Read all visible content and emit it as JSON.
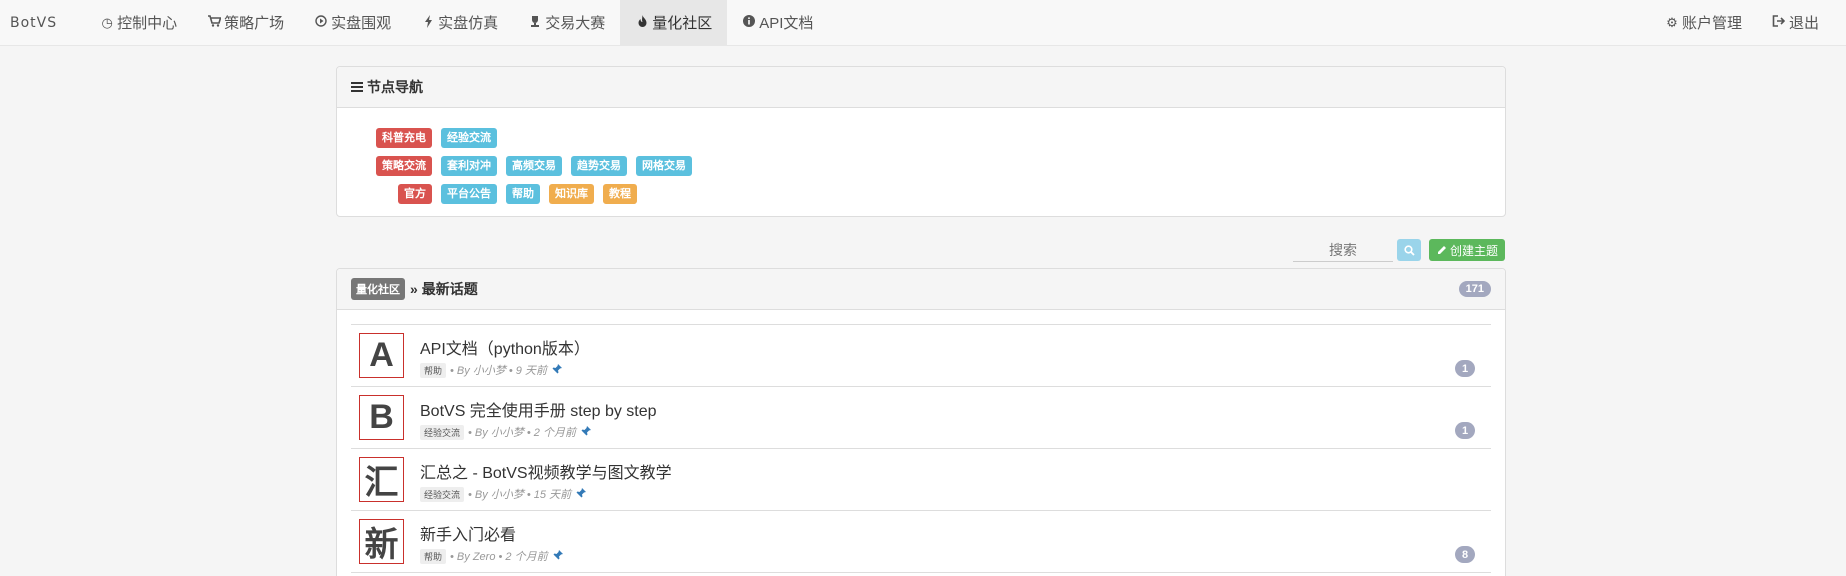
{
  "navbar": {
    "brand": "BotVS",
    "items": [
      {
        "label": "控制中心",
        "icon": "clock-icon",
        "glyph": "◷"
      },
      {
        "label": "策略广场",
        "icon": "cart-icon",
        "glyph": "🛒"
      },
      {
        "label": "实盘围观",
        "icon": "play-circle-icon",
        "glyph": "▶"
      },
      {
        "label": "实盘仿真",
        "icon": "bolt-icon",
        "glyph": "⚡"
      },
      {
        "label": "交易大赛",
        "icon": "trophy-icon",
        "glyph": "♛"
      },
      {
        "label": "量化社区",
        "icon": "fire-icon",
        "glyph": "🔥",
        "active": true
      },
      {
        "label": "API文档",
        "icon": "info-circle-icon",
        "glyph": "ℹ"
      }
    ],
    "right": [
      {
        "label": "账户管理",
        "icon": "gear-icon",
        "glyph": "⚙"
      },
      {
        "label": "退出",
        "icon": "logout-icon",
        "glyph": "⇥"
      }
    ]
  },
  "node_nav": {
    "title": "节点导航",
    "rows": [
      {
        "tags": [
          {
            "label": "科普充电",
            "color": "red"
          },
          {
            "label": "经验交流",
            "color": "blue"
          }
        ]
      },
      {
        "tags": [
          {
            "label": "策略交流",
            "color": "red"
          },
          {
            "label": "套利对冲",
            "color": "blue"
          },
          {
            "label": "高频交易",
            "color": "blue"
          },
          {
            "label": "趋势交易",
            "color": "blue"
          },
          {
            "label": "网格交易",
            "color": "blue"
          }
        ]
      },
      {
        "tags": [
          {
            "label": "官方",
            "color": "red"
          },
          {
            "label": "平台公告",
            "color": "blue"
          },
          {
            "label": "帮助",
            "color": "blue"
          },
          {
            "label": "知识库",
            "color": "orange"
          },
          {
            "label": "教程",
            "color": "orange"
          }
        ]
      }
    ]
  },
  "search": {
    "placeholder": "搜索"
  },
  "create_button": {
    "label": "创建主题"
  },
  "topics": {
    "breadcrumb_tag": "量化社区",
    "separator": "»",
    "heading": "最新话题",
    "count": "171",
    "items": [
      {
        "avatar": "A",
        "title": "API文档（python版本）",
        "tag": "帮助",
        "meta": "• By 小小梦 • 9 天前",
        "replies": "1"
      },
      {
        "avatar": "B",
        "title": "BotVS 完全使用手册 step by step",
        "tag": "经验交流",
        "meta": "• By 小小梦 • 2 个月前",
        "replies": "1"
      },
      {
        "avatar": "汇",
        "title": "汇总之 - BotVS视频教学与图文教学",
        "tag": "经验交流",
        "meta": "• By 小小梦 • 15 天前",
        "replies": ""
      },
      {
        "avatar": "新",
        "title": "新手入门必看",
        "tag": "帮助",
        "meta": "• By Zero • 2 个月前",
        "replies": "8"
      }
    ]
  },
  "colors": {
    "red": "#d9534f",
    "blue": "#5bc0de",
    "orange": "#f0ad4e",
    "green": "#5cb85c"
  }
}
